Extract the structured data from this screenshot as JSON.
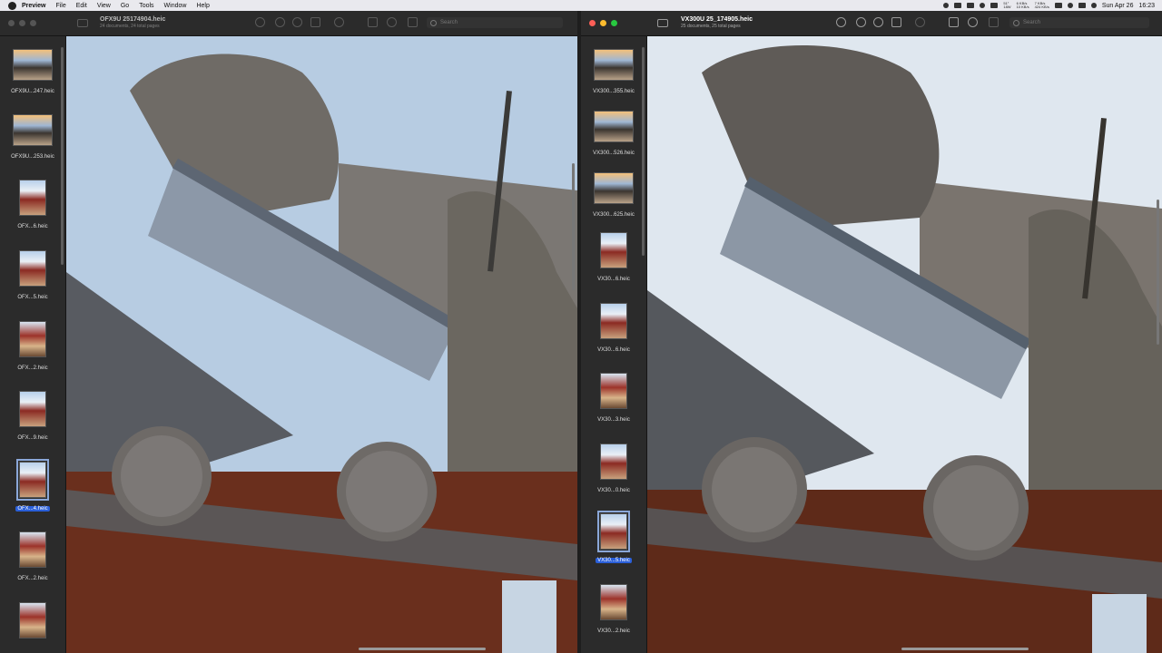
{
  "menubar": {
    "app_name": "Preview",
    "menus": [
      "File",
      "Edit",
      "View",
      "Go",
      "Tools",
      "Window",
      "Help"
    ],
    "stats": {
      "cpu": "51°",
      "cpu_sub": "18W",
      "net_up": "6 KB/s",
      "net_down": "10 KB/s",
      "disk_r": "7 KB/s",
      "disk_w": "424 KB/s",
      "battery": "PV"
    },
    "date": "Sun Apr 26",
    "time": "16:23"
  },
  "window_left": {
    "title": "OFX9U 25174904.heic",
    "subtitle": "24 documents, 24 total pages",
    "search_placeholder": "Search",
    "thumbnails": [
      {
        "label": "OFX9U...247.heic",
        "shape": "land"
      },
      {
        "label": "OFX9U...253.heic",
        "shape": "land"
      },
      {
        "label": "OFX...6.heic",
        "shape": "port"
      },
      {
        "label": "OFX...5.heic",
        "shape": "port"
      },
      {
        "label": "OFX...2.heic",
        "shape": "port2"
      },
      {
        "label": "OFX...9.heic",
        "shape": "port"
      },
      {
        "label": "OFX...4.heic",
        "shape": "port",
        "selected": true
      },
      {
        "label": "OFX...2.heic",
        "shape": "port2"
      },
      {
        "label": "",
        "shape": "port2"
      }
    ]
  },
  "window_right": {
    "title": "VX300U 25_174905.heic",
    "subtitle": "25 documents, 25 total pages",
    "search_placeholder": "Search",
    "thumbnails": [
      {
        "label": "VX300...355.heic",
        "shape": "land"
      },
      {
        "label": "VX300...526.heic",
        "shape": "land"
      },
      {
        "label": "VX300...625.heic",
        "shape": "land"
      },
      {
        "label": "VX30...6.heic",
        "shape": "port"
      },
      {
        "label": "VX30...6.heic",
        "shape": "port"
      },
      {
        "label": "VX30...3.heic",
        "shape": "port2"
      },
      {
        "label": "VX30...0.heic",
        "shape": "port"
      },
      {
        "label": "VX30...5.heic",
        "shape": "port",
        "selected": true
      },
      {
        "label": "VX30...2.heic",
        "shape": "port2"
      }
    ]
  }
}
